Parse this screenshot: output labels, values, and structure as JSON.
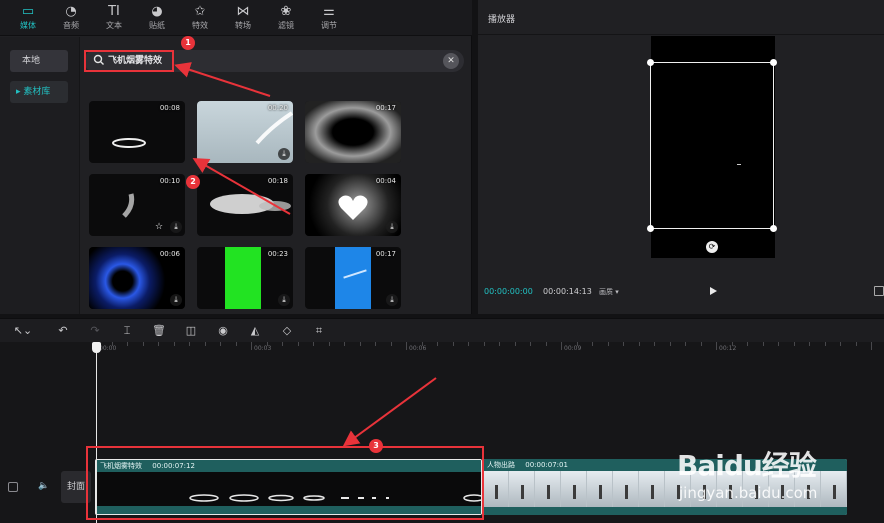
{
  "tabs": [
    {
      "icon": "media-icon",
      "glyph": "▭",
      "label": "媒体",
      "active": true
    },
    {
      "icon": "audio-icon",
      "glyph": "◔",
      "label": "音频",
      "active": false
    },
    {
      "icon": "text-icon",
      "glyph": "TI",
      "label": "文本",
      "active": false
    },
    {
      "icon": "sticker-icon",
      "glyph": "◕",
      "label": "贴纸",
      "active": false
    },
    {
      "icon": "effects-icon",
      "glyph": "✩",
      "label": "特效",
      "active": false
    },
    {
      "icon": "transition-icon",
      "glyph": "⋈",
      "label": "转场",
      "active": false
    },
    {
      "icon": "filter-icon",
      "glyph": "❀",
      "label": "滤镜",
      "active": false
    },
    {
      "icon": "adjust-icon",
      "glyph": "⚌",
      "label": "调节",
      "active": false
    }
  ],
  "left_nav": {
    "local": "本地",
    "library": "▸ 素材库"
  },
  "search": {
    "query": "飞机烟雾特效",
    "clear_glyph": "✕"
  },
  "thumbnails": [
    {
      "duration": "00:08",
      "kind": "ring",
      "download": false,
      "favorite": false
    },
    {
      "duration": "00:20",
      "kind": "sky",
      "download": true,
      "favorite": false
    },
    {
      "duration": "00:17",
      "kind": "smoke-frame",
      "download": false,
      "favorite": false
    },
    {
      "duration": "00:10",
      "kind": "wisp",
      "download": true,
      "favorite": true
    },
    {
      "duration": "00:18",
      "kind": "cloud",
      "download": false,
      "favorite": false
    },
    {
      "duration": "00:04",
      "kind": "heart",
      "download": true,
      "favorite": false
    },
    {
      "duration": "00:06",
      "kind": "portal",
      "download": true,
      "favorite": false
    },
    {
      "duration": "00:23",
      "kind": "green",
      "download": true,
      "favorite": false
    },
    {
      "duration": "00:17",
      "kind": "blue",
      "download": true,
      "favorite": false
    }
  ],
  "player": {
    "title": "播放器",
    "time_current": "00:00:00:00",
    "time_total": "00:00:14:13",
    "ratio_label": "画质 ▾"
  },
  "toolbar_tools": [
    {
      "icon": "select-pointer-icon",
      "glyph": "↖⌄",
      "disabled": false
    },
    {
      "icon": "undo-icon",
      "glyph": "↶",
      "disabled": false
    },
    {
      "icon": "redo-icon",
      "glyph": "↷",
      "disabled": true
    },
    {
      "icon": "split-icon",
      "glyph": "⌶",
      "disabled": false
    },
    {
      "icon": "delete-icon",
      "glyph": "🗑",
      "disabled": false
    },
    {
      "icon": "freeze-icon",
      "glyph": "◫",
      "disabled": false
    },
    {
      "icon": "reverse-icon",
      "glyph": "◉",
      "disabled": false
    },
    {
      "icon": "mirror-icon",
      "glyph": "◭",
      "disabled": false
    },
    {
      "icon": "rotate-icon",
      "glyph": "◇",
      "disabled": false
    },
    {
      "icon": "crop-icon",
      "glyph": "⌗",
      "disabled": false
    }
  ],
  "ruler": [
    "00:00",
    "00:03",
    "00:06",
    "00:09",
    "00:12"
  ],
  "tracks": {
    "cover_label": "封面",
    "clip1": {
      "name": "飞机烟雾特效",
      "duration": "00:00:07:12"
    },
    "clip2": {
      "name": "人物出路",
      "duration": "00:00:07:01"
    }
  },
  "annotations": [
    "1",
    "2",
    "3"
  ],
  "watermark": {
    "logo": "Baidu经验",
    "url": "jingyan.baidu.com"
  },
  "colors": {
    "accent": "#22c1c3",
    "annotation": "#e8333a",
    "clip_header": "#1f5f5e"
  }
}
